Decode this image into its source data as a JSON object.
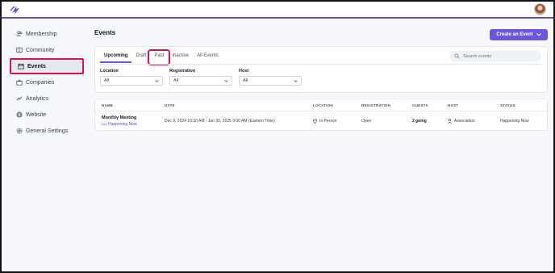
{
  "app": {
    "brand_color": "#5b4fcf",
    "accent": "#6b57dd",
    "highlight": "#d6154d"
  },
  "topbar": {
    "logo_icon": "lightning-logo-icon",
    "avatar": "user-avatar"
  },
  "sidebar": {
    "items": [
      {
        "label": "Membership",
        "icon": "users-icon"
      },
      {
        "label": "Community",
        "icon": "book-icon"
      },
      {
        "label": "Events",
        "icon": "calendar-icon",
        "active": true
      },
      {
        "label": "Companies",
        "icon": "briefcase-icon"
      },
      {
        "label": "Analytics",
        "icon": "chart-icon"
      },
      {
        "label": "Website",
        "icon": "globe-icon"
      },
      {
        "label": "General Settings",
        "icon": "gear-icon"
      }
    ]
  },
  "main": {
    "title": "Events",
    "create_button": "Create an Event",
    "tabs": [
      {
        "label": "Upcoming",
        "active": true
      },
      {
        "label": "Draft"
      },
      {
        "label": "Past",
        "highlighted": true
      },
      {
        "label": "Inactive"
      },
      {
        "label": "All Events"
      }
    ],
    "search": {
      "placeholder": "Search events"
    },
    "filters": [
      {
        "label": "Location",
        "value": "All"
      },
      {
        "label": "Registration",
        "value": "All"
      },
      {
        "label": "Host",
        "value": "All"
      }
    ],
    "table": {
      "columns": [
        "NAME",
        "DATE",
        "LOCATION",
        "REGISTRATION",
        "GUESTS",
        "HOST",
        "STATUS"
      ],
      "rows": [
        {
          "name": "Monthly Meeting",
          "badge": "Happening Now",
          "date": "Dec 9, 2024 10:30 AM - Jan 30, 2025 9:00 AM (Eastern Time)",
          "location": "In Person",
          "registration": "Open",
          "guests": "2 going",
          "host": "Association",
          "status": "Happening Now"
        }
      ]
    }
  }
}
